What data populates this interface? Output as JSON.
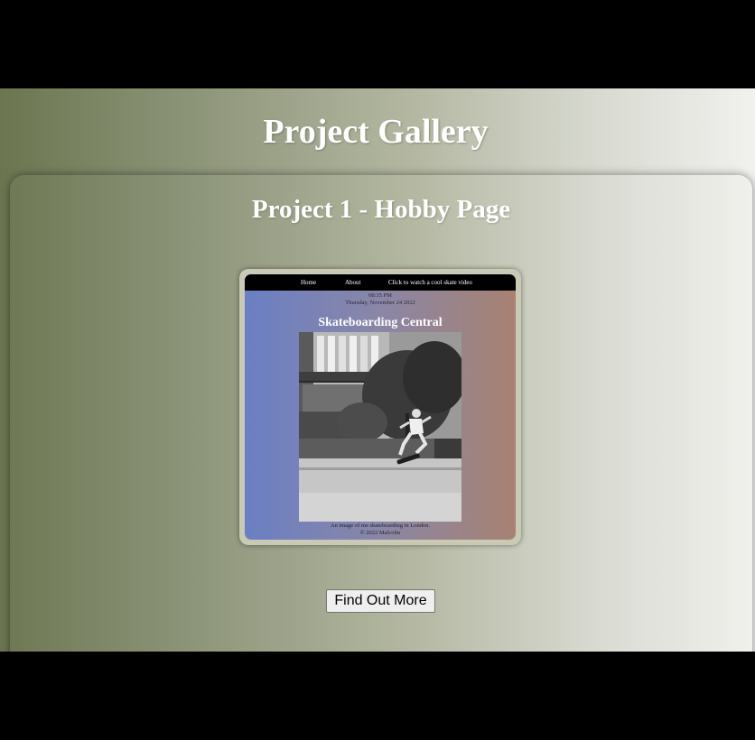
{
  "page": {
    "title": "Project Gallery"
  },
  "project": {
    "title": "Project 1 - Hobby Page",
    "preview": {
      "nav": {
        "home": "Home",
        "about": "About",
        "video": "Click to watch a cool skate video"
      },
      "time": "08:35 PM",
      "date": "Thursday, November 24 2022",
      "heading": "Skateboarding Central",
      "photo_icon": "skateboarder-photo-icon",
      "caption": "An image of me skateboarding in London.",
      "copyright": "© 2022 Malcolm"
    },
    "button_label": "Find Out More"
  },
  "colors": {
    "gradient_left": "#6b7650",
    "gradient_right": "#f1f1ee",
    "preview_left": "#6a7fc4",
    "preview_right": "#a88272",
    "letterbox": "#000000"
  }
}
